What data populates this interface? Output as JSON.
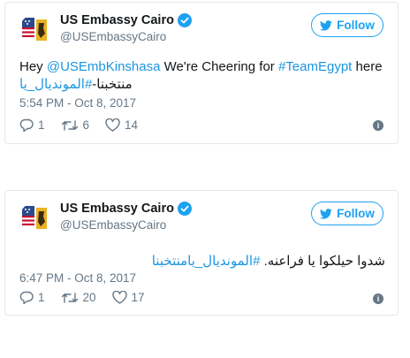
{
  "colors": {
    "accent": "#1da1f2",
    "link": "#1b95e0",
    "muted": "#657786",
    "border": "#e1e8ed",
    "text": "#14171a"
  },
  "tweets": [
    {
      "author_name": "US Embassy Cairo",
      "author_handle": "@USEmbassyCairo",
      "follow_label": "Follow",
      "text_prefix": "Hey ",
      "mention": "@USEmbKinshasa",
      "text_middle": " We're Cheering for ",
      "hashtag": "#TeamEgypt",
      "text_suffix": " here",
      "arabic_prefix": "منتخبنا-",
      "arabic_hashtag": "#المونديال_يا",
      "timestamp": "5:54 PM - Oct 8, 2017",
      "replies": "1",
      "retweets": "6",
      "likes": "14",
      "icons": [
        "verified-badge-icon",
        "twitter-bird-icon",
        "reply-icon",
        "retweet-icon",
        "like-icon",
        "info-icon"
      ]
    },
    {
      "author_name": "US Embassy Cairo",
      "author_handle": "@USEmbassyCairo",
      "follow_label": "Follow",
      "arabic_text": "شدوا حيلكوا يا فراعنه. ",
      "arabic_hashtag": "#المونديال_يامنتخبنا",
      "timestamp": "6:47 PM - Oct 8, 2017",
      "replies": "1",
      "retweets": "20",
      "likes": "17",
      "icons": [
        "verified-badge-icon",
        "twitter-bird-icon",
        "reply-icon",
        "retweet-icon",
        "like-icon",
        "info-icon"
      ]
    }
  ]
}
